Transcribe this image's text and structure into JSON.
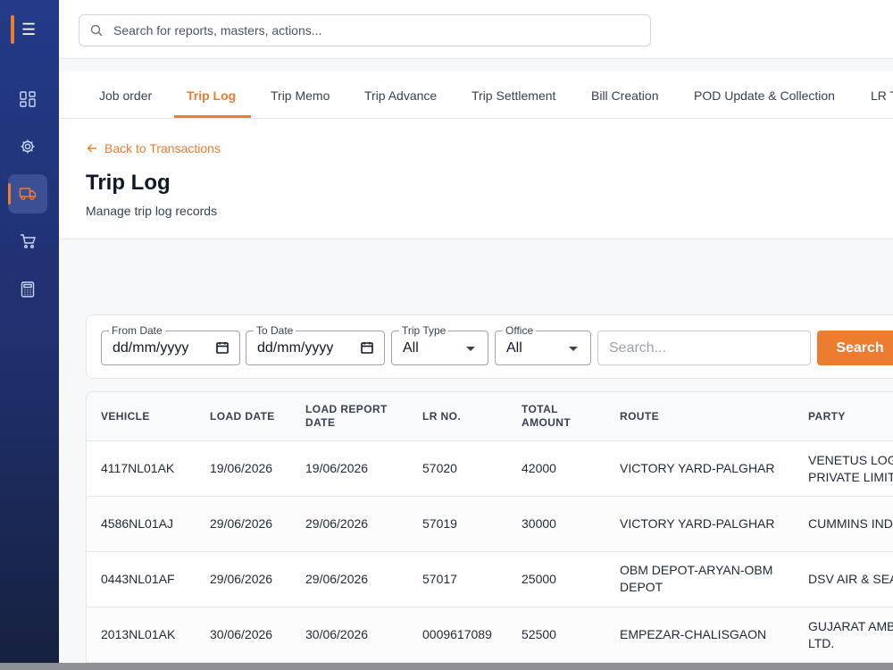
{
  "sidebar": {
    "toggle_icon": "menu-icon",
    "items": [
      {
        "icon": "dashboard-icon",
        "active": false
      },
      {
        "icon": "gear-icon",
        "active": false
      },
      {
        "icon": "truck-icon",
        "active": true
      },
      {
        "icon": "cart-icon",
        "active": false
      },
      {
        "icon": "calculator-icon",
        "active": false
      }
    ]
  },
  "topbar": {
    "search_placeholder": "Search for reports, masters, actions..."
  },
  "tabs": [
    {
      "label": "Job order"
    },
    {
      "label": "Trip Log",
      "active": true
    },
    {
      "label": "Trip Memo"
    },
    {
      "label": "Trip Advance"
    },
    {
      "label": "Trip Settlement"
    },
    {
      "label": "Bill Creation"
    },
    {
      "label": "POD Update & Collection"
    },
    {
      "label": "LR T"
    }
  ],
  "header": {
    "back_label": "Back to Transactions",
    "title": "Trip Log",
    "subtitle": "Manage trip log records"
  },
  "filters": {
    "from_date": {
      "label": "From Date",
      "value": "dd/mm/yyyy"
    },
    "to_date": {
      "label": "To Date",
      "value": "dd/mm/yyyy"
    },
    "trip_type": {
      "label": "Trip Type",
      "value": "All"
    },
    "office": {
      "label": "Office",
      "value": "All"
    },
    "search_placeholder": "Search...",
    "search_button": "Search"
  },
  "table": {
    "columns": [
      {
        "line1": "VEHICLE",
        "line2": ""
      },
      {
        "line1": "LOAD DATE",
        "line2": ""
      },
      {
        "line1": "LOAD REPORT",
        "line2": "DATE"
      },
      {
        "line1": "LR NO.",
        "line2": ""
      },
      {
        "line1": "TOTAL",
        "line2": "AMOUNT"
      },
      {
        "line1": "ROUTE",
        "line2": ""
      },
      {
        "line1": "PARTY",
        "line2": ""
      }
    ],
    "rows": [
      {
        "vehicle": "4117NL01AK",
        "load_date": "19/06/2026",
        "report_date": "19/06/2026",
        "lr_no": "57020",
        "amount": "42000",
        "route_1": "VICTORY YARD-PALGHAR",
        "route_2": "",
        "party_1": "VENETUS LOGI",
        "party_2": "PRIVATE LIMITE"
      },
      {
        "vehicle": "4586NL01AJ",
        "load_date": "29/06/2026",
        "report_date": "29/06/2026",
        "lr_no": "57019",
        "amount": "30000",
        "route_1": "VICTORY YARD-PALGHAR",
        "route_2": "",
        "party_1": "CUMMINS INDI",
        "party_2": ""
      },
      {
        "vehicle": "0443NL01AF",
        "load_date": "29/06/2026",
        "report_date": "29/06/2026",
        "lr_no": "57017",
        "amount": "25000",
        "route_1": "OBM DEPOT-ARYAN-OBM",
        "route_2": "DEPOT",
        "party_1": "DSV AIR & SEA",
        "party_2": ""
      },
      {
        "vehicle": "2013NL01AK",
        "load_date": "30/06/2026",
        "report_date": "30/06/2026",
        "lr_no": "0009617089",
        "amount": "52500",
        "route_1": "EMPEZAR-CHALISGAON",
        "route_2": "",
        "party_1": "GUJARAT AMB",
        "party_2": "LTD."
      }
    ]
  }
}
